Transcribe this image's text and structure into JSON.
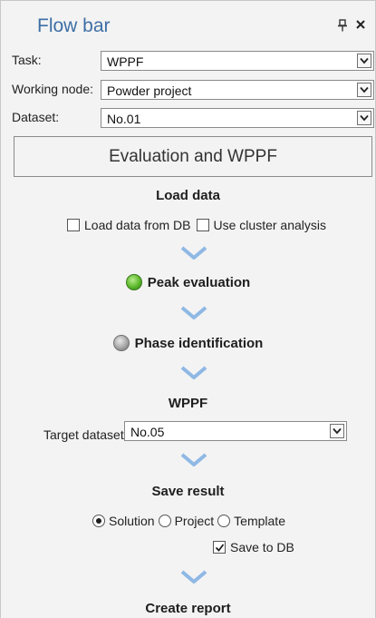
{
  "panel": {
    "title": "Flow bar"
  },
  "fields": {
    "task": {
      "label": "Task:",
      "value": "WPPF"
    },
    "working_node": {
      "label": "Working node:",
      "value": "Powder project"
    },
    "dataset": {
      "label": "Dataset:",
      "value": "No.01"
    }
  },
  "section": {
    "title": "Evaluation and WPPF"
  },
  "steps": {
    "load_data": {
      "title": "Load data",
      "options": {
        "load_from_db": "Load data from DB",
        "use_cluster": "Use cluster analysis"
      }
    },
    "peak_evaluation": {
      "title": "Peak evaluation",
      "status_color": "#5cb82c"
    },
    "phase_identification": {
      "title": "Phase identification",
      "status_color": "#a6a6a6"
    },
    "wppf": {
      "title": "WPPF",
      "target_label": "Target dataset",
      "target_value": "No.05"
    },
    "save_result": {
      "title": "Save result",
      "options": {
        "solution": "Solution",
        "project": "Project",
        "template": "Template"
      },
      "selected": "Solution",
      "save_to_db": "Save to DB"
    },
    "create_report": {
      "title": "Create report"
    }
  },
  "colors": {
    "title_blue": "#3e6fa5",
    "chevron_blue": "#8fb8e4"
  },
  "icons": [
    "pin-icon",
    "close-icon",
    "dropdown-arrow-icon",
    "chevron-down-icon",
    "status-dot-icon"
  ]
}
